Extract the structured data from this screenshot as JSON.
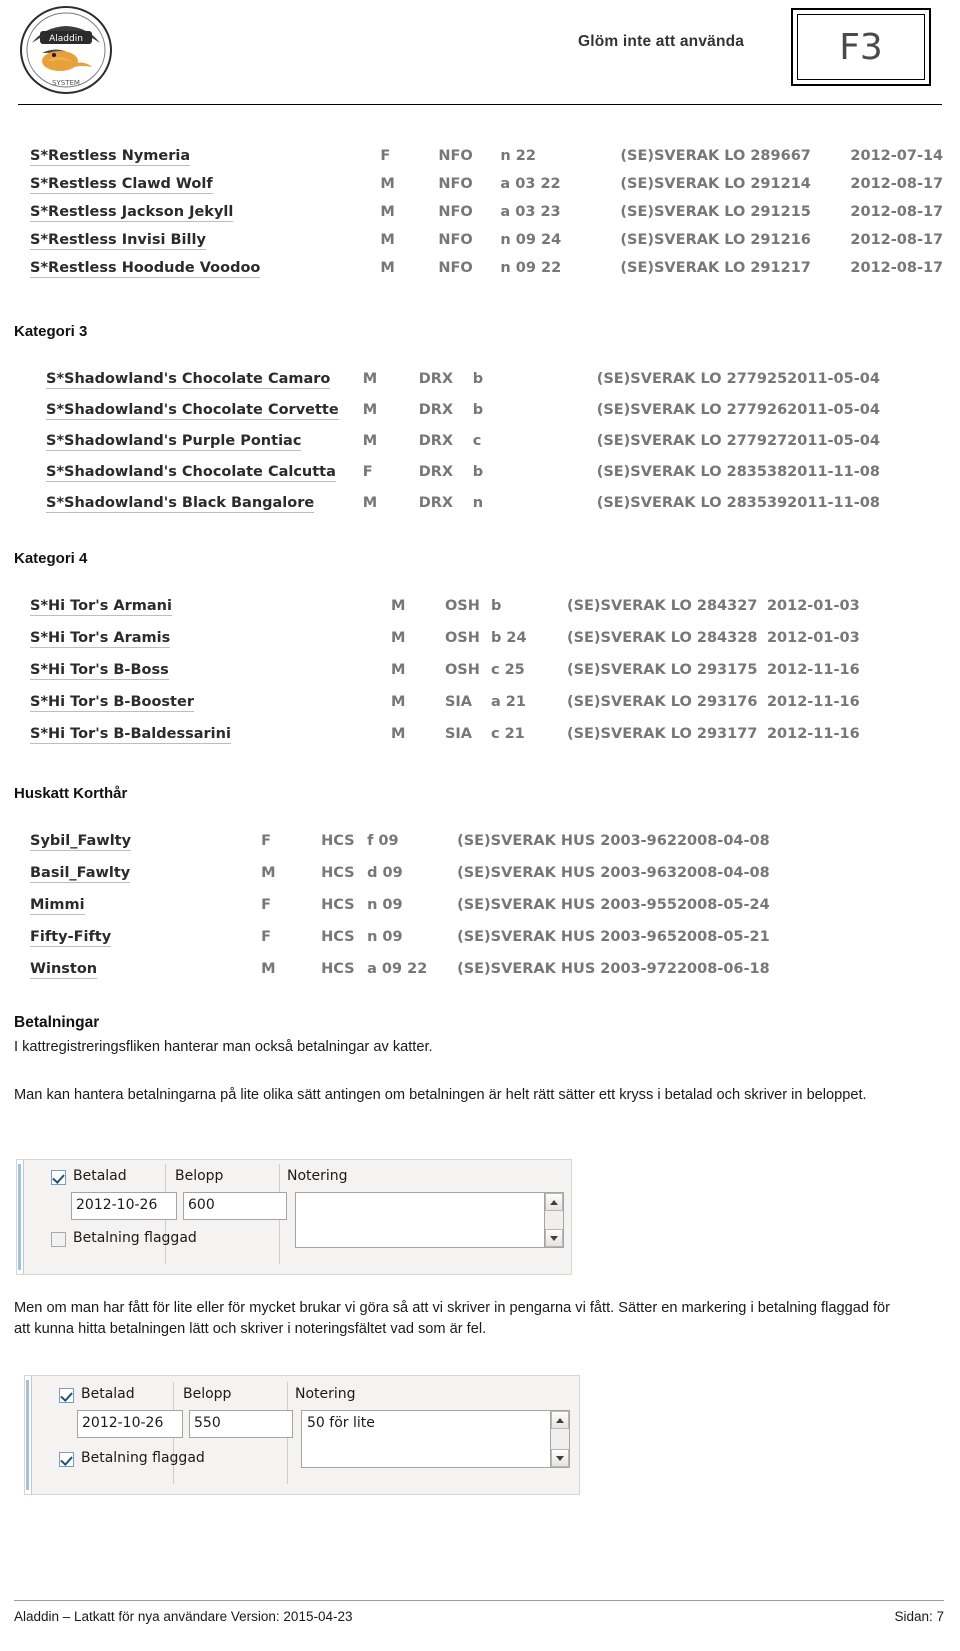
{
  "header": {
    "reminder_text": "Glöm inte att använda",
    "fkey_label": "F3",
    "logo_name": "Aladdin"
  },
  "sections": {
    "top_list": {
      "rows": [
        {
          "name": "S*Restless Nymeria",
          "sex": "F",
          "breed": "NFO",
          "code": "n 22",
          "reg": "(SE)SVERAK LO 289667",
          "date": "2012-07-14"
        },
        {
          "name": "S*Restless Clawd Wolf",
          "sex": "M",
          "breed": "NFO",
          "code": "a 03 22",
          "reg": "(SE)SVERAK LO 291214",
          "date": "2012-08-17"
        },
        {
          "name": "S*Restless Jackson Jekyll",
          "sex": "M",
          "breed": "NFO",
          "code": "a 03 23",
          "reg": "(SE)SVERAK LO 291215",
          "date": "2012-08-17"
        },
        {
          "name": "S*Restless Invisi Billy",
          "sex": "M",
          "breed": "NFO",
          "code": "n 09 24",
          "reg": "(SE)SVERAK LO 291216",
          "date": "2012-08-17"
        },
        {
          "name": "S*Restless Hoodude Voodoo",
          "sex": "M",
          "breed": "NFO",
          "code": "n 09 22",
          "reg": "(SE)SVERAK LO 291217",
          "date": "2012-08-17"
        }
      ]
    },
    "kategori3": {
      "title": "Kategori 3",
      "rows": [
        {
          "name": "S*Shadowland's Chocolate Camaro",
          "sex": "M",
          "breed": "DRX",
          "code": "b",
          "reg": "(SE)SVERAK LO 277925",
          "date": "2011-05-04"
        },
        {
          "name": "S*Shadowland's Chocolate Corvette",
          "sex": "M",
          "breed": "DRX",
          "code": "b",
          "reg": "(SE)SVERAK LO 277926",
          "date": "2011-05-04"
        },
        {
          "name": "S*Shadowland's Purple Pontiac",
          "sex": "M",
          "breed": "DRX",
          "code": "c",
          "reg": "(SE)SVERAK LO 277927",
          "date": "2011-05-04"
        },
        {
          "name": "S*Shadowland's Chocolate Calcutta",
          "sex": "F",
          "breed": "DRX",
          "code": "b",
          "reg": "(SE)SVERAK LO 283538",
          "date": "2011-11-08"
        },
        {
          "name": "S*Shadowland's Black Bangalore",
          "sex": "M",
          "breed": "DRX",
          "code": "n",
          "reg": "(SE)SVERAK LO 283539",
          "date": "2011-11-08"
        }
      ]
    },
    "kategori4": {
      "title": "Kategori 4",
      "rows": [
        {
          "name": "S*Hi Tor's Armani",
          "sex": "M",
          "breed": "OSH",
          "code": "b",
          "reg": "(SE)SVERAK LO 284327",
          "date": "2012-01-03"
        },
        {
          "name": "S*Hi Tor's Aramis",
          "sex": "M",
          "breed": "OSH",
          "code": "b 24",
          "reg": "(SE)SVERAK LO 284328",
          "date": "2012-01-03"
        },
        {
          "name": "S*Hi Tor's B-Boss",
          "sex": "M",
          "breed": "OSH",
          "code": "c 25",
          "reg": "(SE)SVERAK LO 293175",
          "date": "2012-11-16"
        },
        {
          "name": "S*Hi Tor's B-Booster",
          "sex": "M",
          "breed": "SIA",
          "code": "a 21",
          "reg": "(SE)SVERAK LO 293176",
          "date": "2012-11-16"
        },
        {
          "name": "S*Hi Tor's B-Baldessarini",
          "sex": "M",
          "breed": "SIA",
          "code": "c 21",
          "reg": "(SE)SVERAK LO 293177",
          "date": "2012-11-16"
        }
      ]
    },
    "huskatt": {
      "title": "Huskatt Korthår",
      "rows": [
        {
          "name": "Sybil_Fawlty",
          "sex": "F",
          "breed": "HCS",
          "code": "f 09",
          "reg": "(SE)SVERAK HUS 2003-962",
          "date": "2008-04-08"
        },
        {
          "name": "Basil_Fawlty",
          "sex": "M",
          "breed": "HCS",
          "code": "d 09",
          "reg": "(SE)SVERAK HUS 2003-963",
          "date": "2008-04-08"
        },
        {
          "name": "Mimmi",
          "sex": "F",
          "breed": "HCS",
          "code": "n 09",
          "reg": "(SE)SVERAK HUS 2003-955",
          "date": "2008-05-24"
        },
        {
          "name": "Fifty-Fifty",
          "sex": "F",
          "breed": "HCS",
          "code": "n 09",
          "reg": "(SE)SVERAK HUS 2003-965",
          "date": "2008-05-21"
        },
        {
          "name": "Winston",
          "sex": "M",
          "breed": "HCS",
          "code": "a 09 22",
          "reg": "(SE)SVERAK HUS 2003-972",
          "date": "2008-06-18"
        }
      ]
    }
  },
  "text": {
    "betalningar_heading": "Betalningar",
    "paragraph1": "I kattregistreringsfliken hanterar man också betalningar av katter.",
    "paragraph2": "Man kan hantera betalningarna på lite olika sätt antingen om betalningen är helt rätt sätter ett kryss i betalad och skriver in beloppet.",
    "paragraph3": "Men om man har fått för lite eller för mycket brukar vi göra så att vi skriver in pengarna vi fått. Sätter en markering i betalning flaggad för att kunna hitta betalningen lätt och skriver i noteringsfältet vad som är fel."
  },
  "screenshot1": {
    "label_betalad": "Betalad",
    "label_belopp": "Belopp",
    "label_notering": "Notering",
    "label_flaggad": "Betalning flaggad",
    "date_value": "2012-10-26",
    "amount_value": "600",
    "note_value": "",
    "betalad_checked": true,
    "flaggad_checked": false
  },
  "screenshot2": {
    "label_betalad": "Betalad",
    "label_belopp": "Belopp",
    "label_notering": "Notering",
    "label_flaggad": "Betalning flaggad",
    "date_value": "2012-10-26",
    "amount_value": "550",
    "note_value": "50 för lite",
    "betalad_checked": true,
    "flaggad_checked": true
  },
  "footer": {
    "left": "Aladdin – Latkatt för nya användare Version: 2015-04-23",
    "right": "Sidan: 7"
  }
}
